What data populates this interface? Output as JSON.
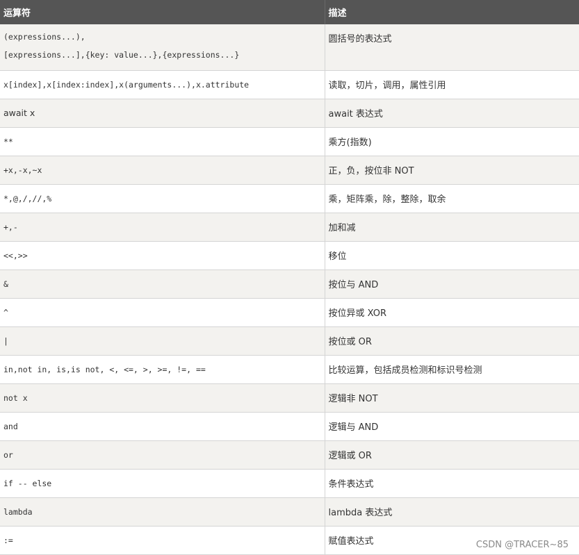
{
  "table": {
    "headers": [
      "运算符",
      "描述"
    ],
    "rows": [
      {
        "op": "(expressions...),\n[expressions...],{key: value...},{expressions...}",
        "desc": "圆括号的表达式"
      },
      {
        "op": "x[index],x[index:index],x(arguments...),x.attribute",
        "desc": "读取，切片，调用，属性引用"
      },
      {
        "op": "await x",
        "desc": "await 表达式"
      },
      {
        "op": "**",
        "desc": "乘方(指数)"
      },
      {
        "op": "+x,-x,~x",
        "desc": "正，负，按位非 NOT"
      },
      {
        "op": "*,@,/,//,%",
        "desc": "乘，矩阵乘，除，整除，取余"
      },
      {
        "op": "+,-",
        "desc": "加和减"
      },
      {
        "op": "<<,>>",
        "desc": "移位"
      },
      {
        "op": "&",
        "desc": "按位与 AND"
      },
      {
        "op": "^",
        "desc": "按位异或 XOR"
      },
      {
        "op": "|",
        "desc": "按位或 OR"
      },
      {
        "op": "in,not in, is,is not, <, <=, >, >=, !=, ==",
        "desc": "比较运算，包括成员检测和标识号检测"
      },
      {
        "op": "not x",
        "desc": "逻辑非 NOT"
      },
      {
        "op": "and",
        "desc": "逻辑与 AND"
      },
      {
        "op": "or",
        "desc": "逻辑或 OR"
      },
      {
        "op": "if -- else",
        "desc": "条件表达式"
      },
      {
        "op": "lambda",
        "desc": "lambda 表达式"
      },
      {
        "op": ":=",
        "desc": "赋值表达式"
      }
    ]
  },
  "watermark": "CSDN @TRACER~85"
}
